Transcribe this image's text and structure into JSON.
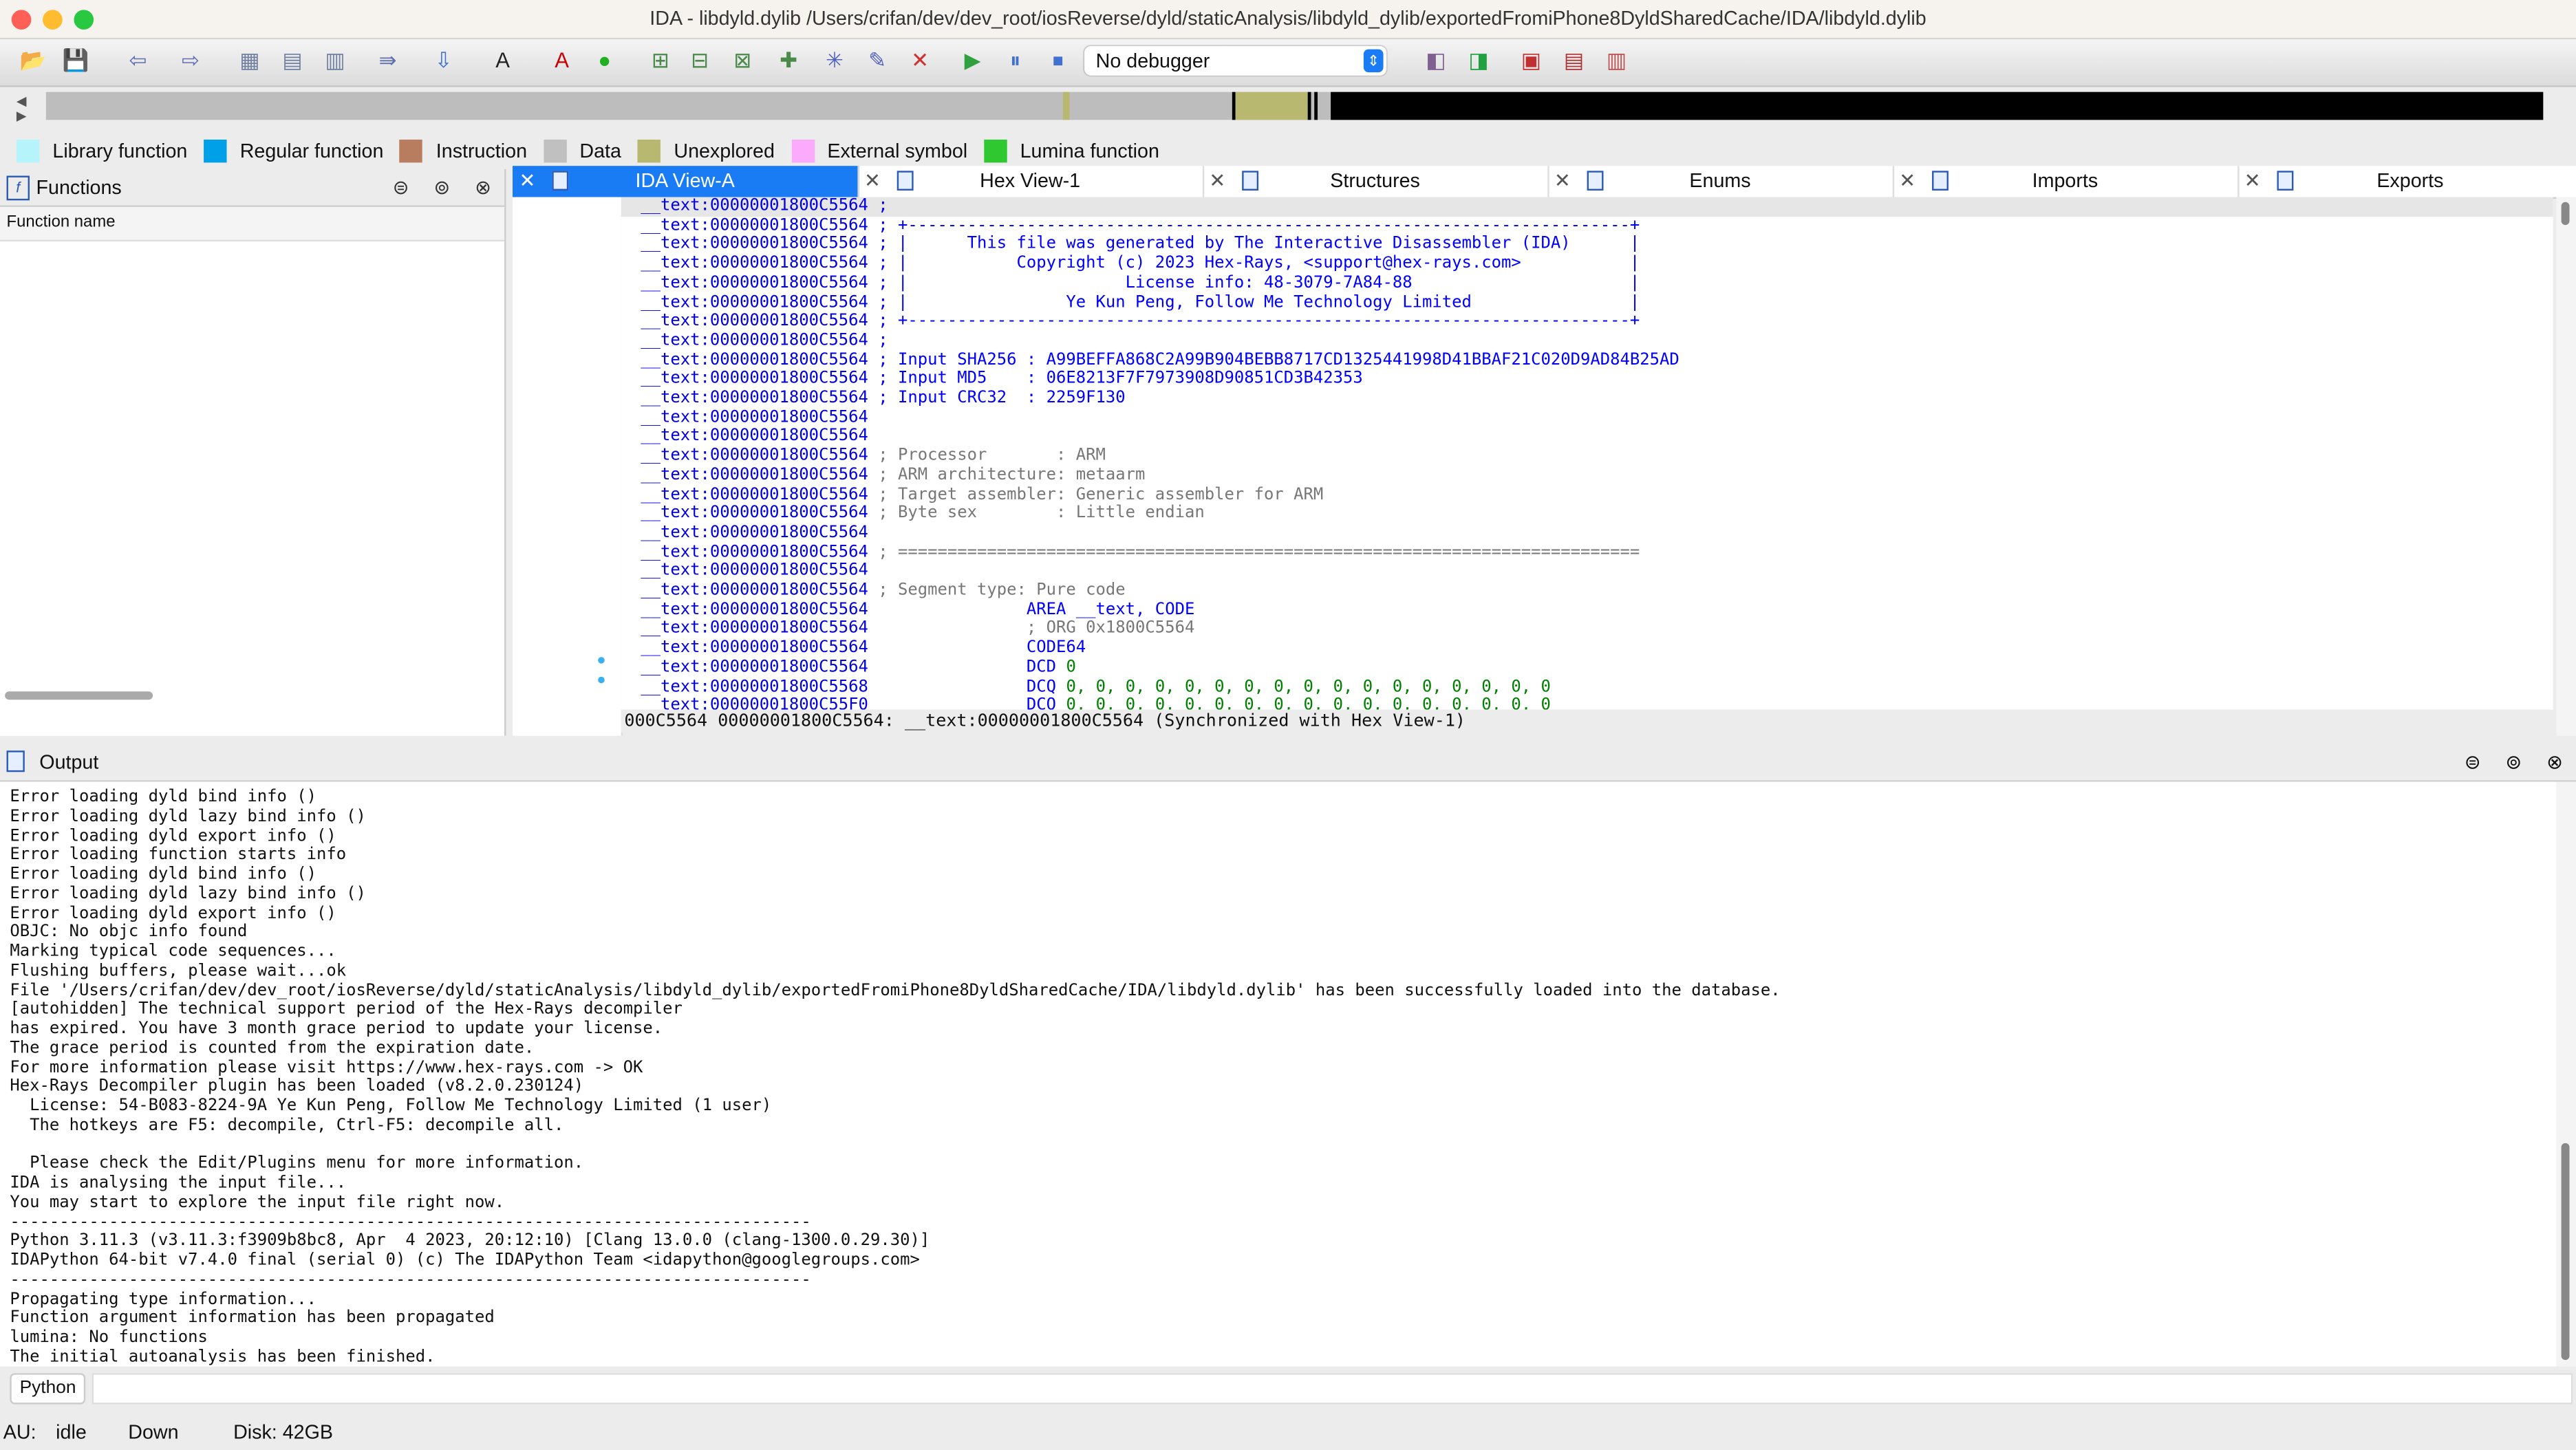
{
  "window": {
    "title": "IDA - libdyld.dylib /Users/crifan/dev/dev_root/iosReverse/dyld/staticAnalysis/libdyld_dylib/exportedFromiPhone8DyldSharedCache/IDA/libdyld.dylib"
  },
  "toolbar": {
    "debugger_select": "No debugger",
    "icons": [
      "open-icon",
      "save-icon",
      "back-icon",
      "forward-icon",
      "hex-icon",
      "text-icon",
      "binary-icon",
      "jump-icon",
      "down-arrow-icon",
      "string-icon",
      "font-icon",
      "green-circle-icon",
      "code-icon",
      "data-icon",
      "struct-icon",
      "func-icon",
      "enum-icon",
      "edit-icon",
      "delete-icon",
      "run-icon",
      "pause-icon",
      "stop-icon"
    ]
  },
  "legend": [
    {
      "label": "Library function",
      "color": "#b6f4fc"
    },
    {
      "label": "Regular function",
      "color": "#00a0e8"
    },
    {
      "label": "Instruction",
      "color": "#b87d5e"
    },
    {
      "label": "Data",
      "color": "#c0c0c0"
    },
    {
      "label": "Unexplored",
      "color": "#b8b870"
    },
    {
      "label": "External symbol",
      "color": "#fcaafc"
    },
    {
      "label": "Lumina function",
      "color": "#30c830"
    }
  ],
  "functions_panel": {
    "title": "Functions",
    "column": "Function name"
  },
  "tabs": [
    {
      "label": "IDA View-A",
      "active": true
    },
    {
      "label": "Hex View-1"
    },
    {
      "label": "Structures"
    },
    {
      "label": "Enums"
    },
    {
      "label": "Imports"
    },
    {
      "label": "Exports"
    }
  ],
  "disasm": {
    "lines": [
      {
        "addr": "__text:00000001800C5564",
        "text": " ;",
        "cls": "blue"
      },
      {
        "addr": "__text:00000001800C5564",
        "text": " ; +-------------------------------------------------------------------------+",
        "cls": "blue"
      },
      {
        "addr": "__text:00000001800C5564",
        "text": " ; |      This file was generated by The Interactive Disassembler (IDA)      |",
        "cls": "blue"
      },
      {
        "addr": "__text:00000001800C5564",
        "text": " ; |           Copyright (c) 2023 Hex-Rays, <support@hex-rays.com>           |",
        "cls": "blue"
      },
      {
        "addr": "__text:00000001800C5564",
        "text": " ; |                      License info: 48-3079-7A84-88                      |",
        "cls": "blue"
      },
      {
        "addr": "__text:00000001800C5564",
        "text": " ; |                Ye Kun Peng, Follow Me Technology Limited                |",
        "cls": "blue"
      },
      {
        "addr": "__text:00000001800C5564",
        "text": " ; +-------------------------------------------------------------------------+",
        "cls": "blue"
      },
      {
        "addr": "__text:00000001800C5564",
        "text": " ;",
        "cls": "blue"
      },
      {
        "addr": "__text:00000001800C5564",
        "text": " ; Input SHA256 : A99BEFFA868C2A99B904BEBB8717CD1325441998D41BBAF21C020D9AD84B25AD",
        "cls": "blue"
      },
      {
        "addr": "__text:00000001800C5564",
        "text": " ; Input MD5    : 06E8213F7F7973908D90851CD3B42353",
        "cls": "blue"
      },
      {
        "addr": "__text:00000001800C5564",
        "text": " ; Input CRC32  : 2259F130",
        "cls": "blue"
      },
      {
        "addr": "__text:00000001800C5564",
        "text": "",
        "cls": "blue"
      },
      {
        "addr": "__text:00000001800C5564",
        "text": "",
        "cls": "blue"
      },
      {
        "addr": "__text:00000001800C5564",
        "text": " ; Processor       : ARM",
        "cls": "gray"
      },
      {
        "addr": "__text:00000001800C5564",
        "text": " ; ARM architecture: metaarm",
        "cls": "gray"
      },
      {
        "addr": "__text:00000001800C5564",
        "text": " ; Target assembler: Generic assembler for ARM",
        "cls": "gray"
      },
      {
        "addr": "__text:00000001800C5564",
        "text": " ; Byte sex        : Little endian",
        "cls": "gray"
      },
      {
        "addr": "__text:00000001800C5564",
        "text": "",
        "cls": "gray"
      },
      {
        "addr": "__text:00000001800C5564",
        "text": " ; ===========================================================================",
        "cls": "gray"
      },
      {
        "addr": "__text:00000001800C5564",
        "text": "",
        "cls": "gray"
      },
      {
        "addr": "__text:00000001800C5564",
        "text": " ; Segment type: Pure code",
        "cls": "gray"
      },
      {
        "addr": "__text:00000001800C5564",
        "text": "                AREA __text, CODE",
        "cls": "blue"
      },
      {
        "addr": "__text:00000001800C5564",
        "text": "                ; ORG 0x1800C5564",
        "cls": "gray"
      },
      {
        "addr": "__text:00000001800C5564",
        "text": "                CODE64",
        "cls": "blue"
      },
      {
        "addr": "__text:00000001800C5564",
        "text": "                DCD 0",
        "cls": "blue"
      },
      {
        "addr": "__text:00000001800C5568",
        "text": "                DCQ 0, 0, 0, 0, 0, 0, 0, 0, 0, 0, 0, 0, 0, 0, 0, 0, 0",
        "cls": "green"
      },
      {
        "addr": "__text:00000001800C55F0",
        "text": "                DCQ 0, 0, 0, 0, 0, 0, 0, 0, 0, 0, 0, 0, 0, 0, 0, 0, 0",
        "cls": "green"
      }
    ],
    "status": "000C5564 00000001800C5564: __text:00000001800C5564 (Synchronized with Hex View-1)"
  },
  "output": {
    "title": "Output",
    "lines": [
      "Error loading dyld bind info ()",
      "Error loading dyld lazy bind info ()",
      "Error loading dyld export info ()",
      "Error loading function starts info",
      "Error loading dyld bind info ()",
      "Error loading dyld lazy bind info ()",
      "Error loading dyld export info ()",
      "OBJC: No objc info found",
      "Marking typical code sequences...",
      "Flushing buffers, please wait...ok",
      "File '/Users/crifan/dev/dev_root/iosReverse/dyld/staticAnalysis/libdyld_dylib/exportedFromiPhone8DyldSharedCache/IDA/libdyld.dylib' has been successfully loaded into the database.",
      "[autohidden] The technical support period of the Hex-Rays decompiler",
      "has expired. You have 3 month grace period to update your license.",
      "The grace period is counted from the expiration date.",
      "For more information please visit https://www.hex-rays.com -> OK",
      "Hex-Rays Decompiler plugin has been loaded (v8.2.0.230124)",
      "  License: 54-B083-8224-9A Ye Kun Peng, Follow Me Technology Limited (1 user)",
      "  The hotkeys are F5: decompile, Ctrl-F5: decompile all.",
      "",
      "  Please check the Edit/Plugins menu for more information.",
      "IDA is analysing the input file...",
      "You may start to explore the input file right now.",
      "---------------------------------------------------------------------------------",
      "Python 3.11.3 (v3.11.3:f3909b8bc8, Apr  4 2023, 20:12:10) [Clang 13.0.0 (clang-1300.0.29.30)]",
      "IDAPython 64-bit v7.4.0 final (serial 0) (c) The IDAPython Team <idapython@googlegroups.com>",
      "---------------------------------------------------------------------------------",
      "Propagating type information...",
      "Function argument information has been propagated",
      "lumina: No functions",
      "The initial autoanalysis has been finished."
    ],
    "python_button": "Python"
  },
  "statusbar": {
    "au_label": "AU:",
    "au_state": "idle",
    "direction": "Down",
    "disk": "Disk: 42GB"
  }
}
